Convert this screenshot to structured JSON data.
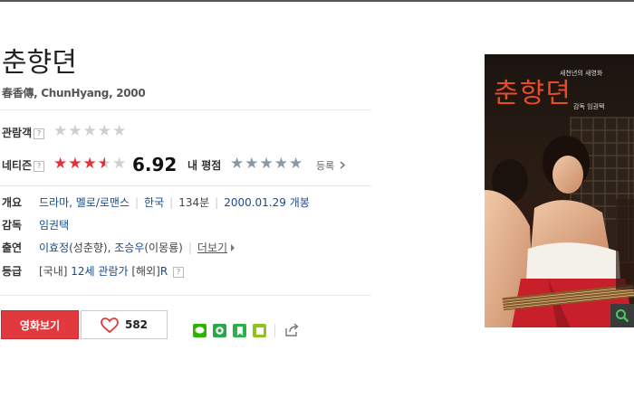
{
  "movie": {
    "title": "춘향뎐",
    "subtitle": "春香傳, ChunHyang, 2000"
  },
  "ratings": {
    "audience_label": "관람객",
    "netizen_label": "네티즌",
    "netizen_score": "6.92",
    "netizen_stars": 3.5,
    "my_rating_label": "내 평점",
    "register_label": "등록",
    "help_mark": "?"
  },
  "info": {
    "overview_label": "개요",
    "genre": "드라마, 멜로/로맨스",
    "country": "한국",
    "runtime": "134분",
    "release": "2000.01.29 개봉",
    "director_label": "감독",
    "director": "임권택",
    "cast_label": "출연",
    "cast_1": "이효정",
    "cast_1_role": "(성춘향)",
    "cast_2": "조승우",
    "cast_2_role": "(이몽룡)",
    "more_label": "더보기",
    "grade_label": "등급",
    "grade_domestic": "[국내]",
    "grade_age": "12세 관람가",
    "grade_overseas": "[해외]",
    "grade_overseas_value": "R"
  },
  "actions": {
    "watch_label": "영화보기",
    "like_count": "582"
  },
  "poster": {
    "title": "춘향뎐",
    "tagline": "새천년의 새영화",
    "director_credit": "감독 임권택"
  },
  "colors": {
    "accent_red": "#e2393f",
    "link_blue": "#1a4b8c",
    "star_red": "#e0333c"
  }
}
